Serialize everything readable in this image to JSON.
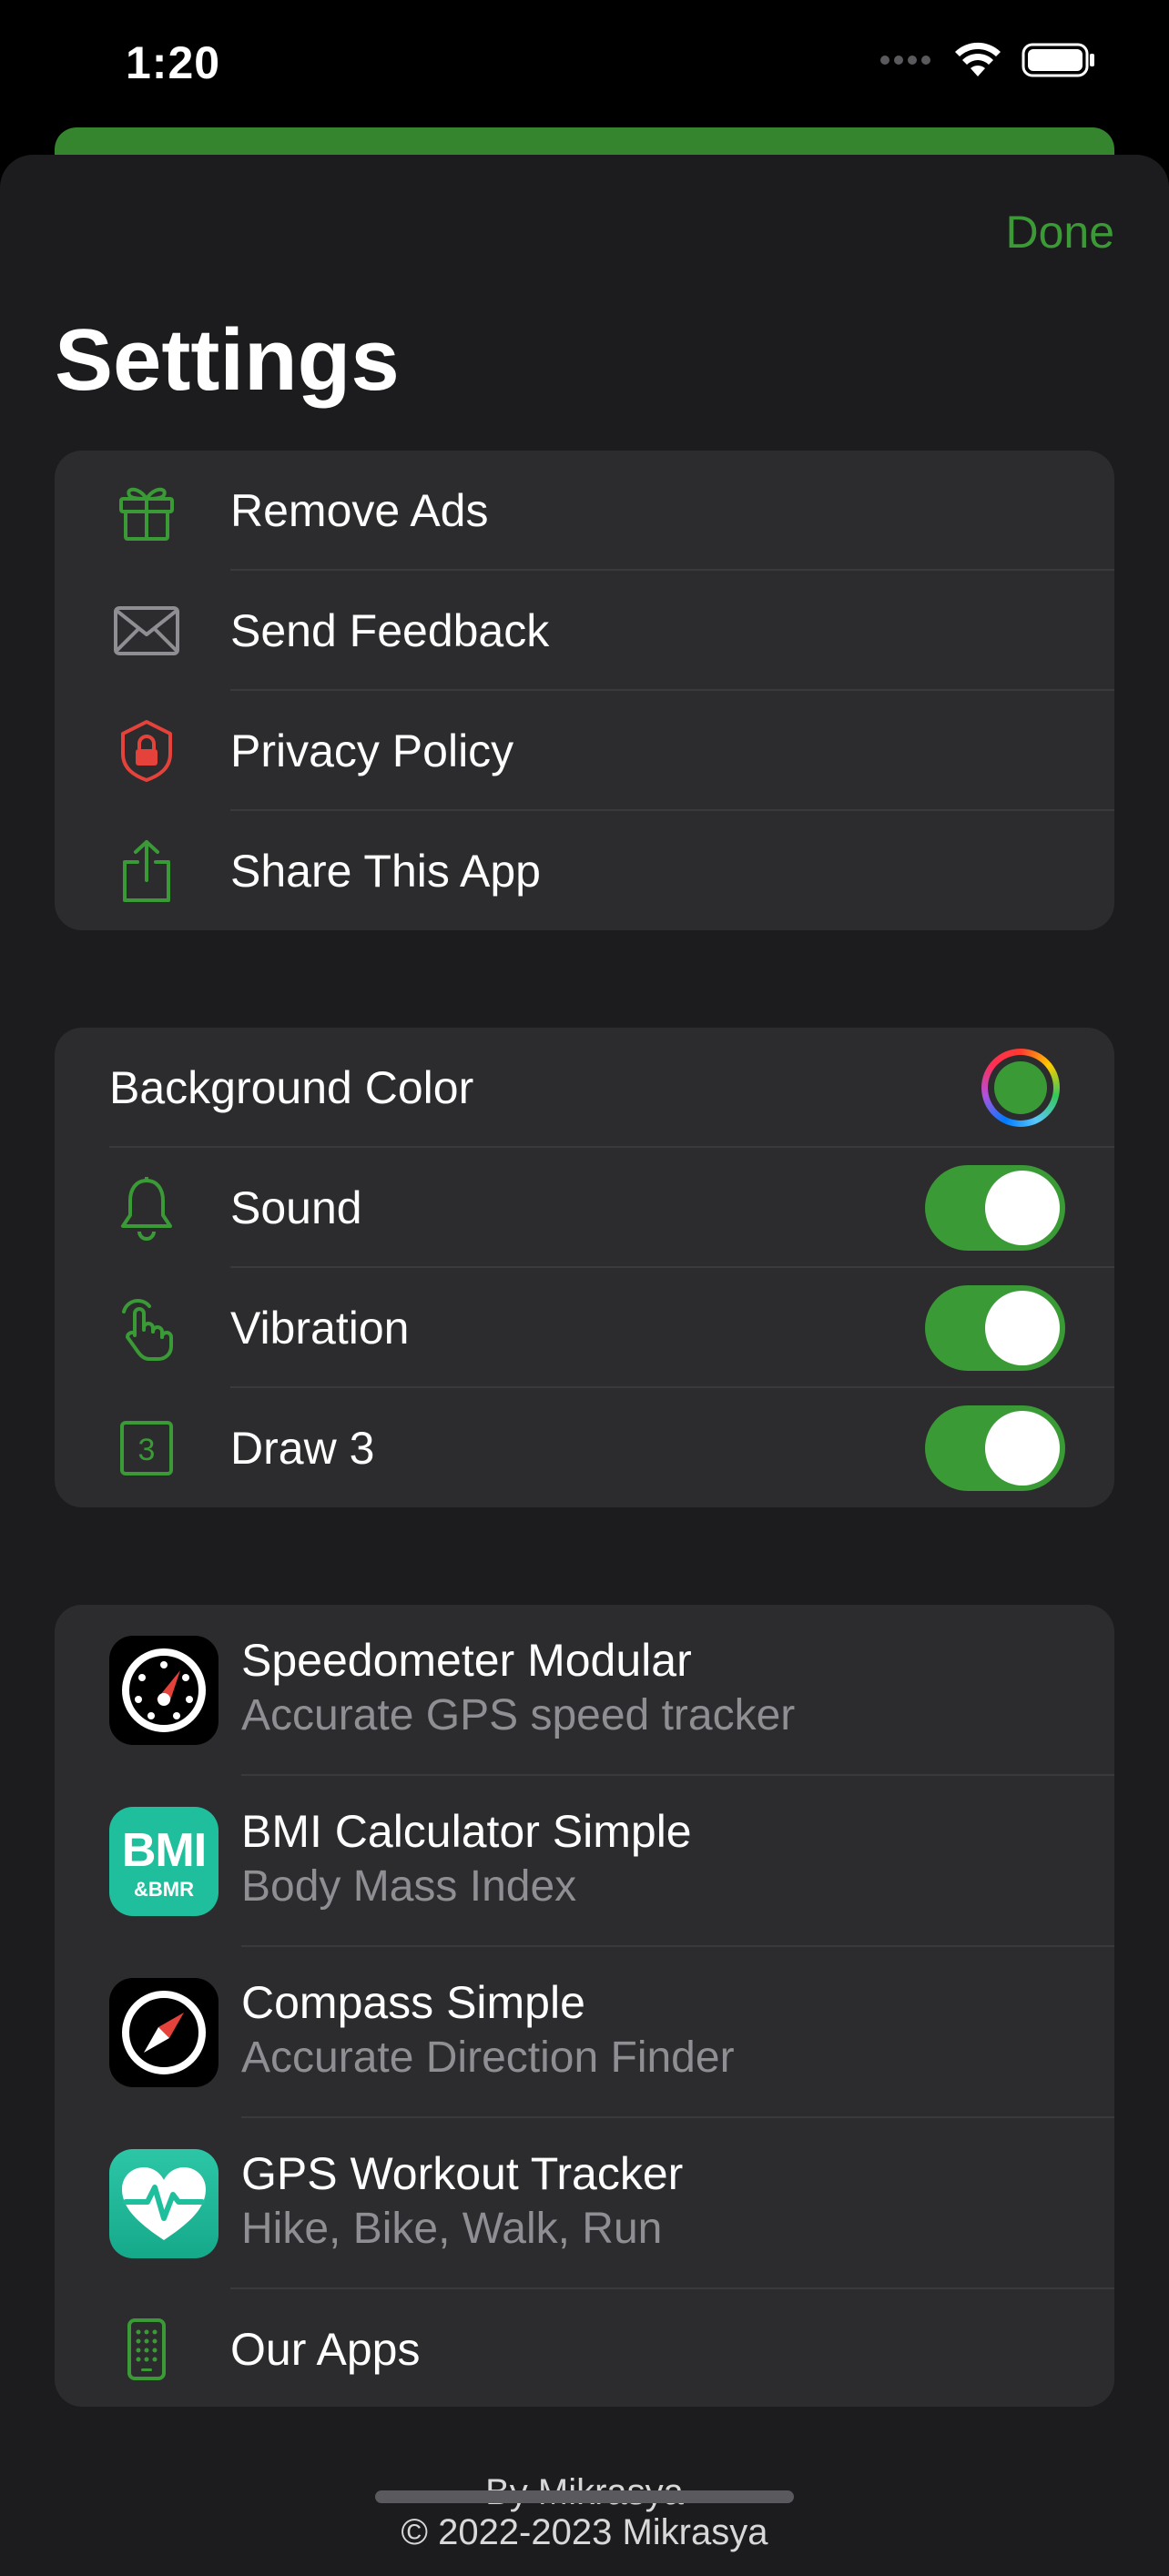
{
  "status_bar": {
    "time": "1:20"
  },
  "header": {
    "done_label": "Done",
    "title": "Settings"
  },
  "general_items": [
    {
      "label": "Remove Ads",
      "icon": "gift-icon"
    },
    {
      "label": "Send Feedback",
      "icon": "envelope-icon"
    },
    {
      "label": "Privacy Policy",
      "icon": "shield-lock-icon"
    },
    {
      "label": "Share This App",
      "icon": "share-icon"
    }
  ],
  "preferences": {
    "background_color": {
      "label": "Background Color",
      "value": "#3a9a36"
    },
    "toggles": [
      {
        "label": "Sound",
        "icon": "bell-icon",
        "on": true
      },
      {
        "label": "Vibration",
        "icon": "tap-hand-icon",
        "on": true
      },
      {
        "label": "Draw 3",
        "icon": "number-3-square-icon",
        "on": true
      }
    ]
  },
  "apps": [
    {
      "title": "Speedometer Modular",
      "subtitle": "Accurate GPS speed tracker",
      "icon": "speedometer-app-icon"
    },
    {
      "title": "BMI Calculator Simple",
      "subtitle": "Body Mass Index",
      "icon": "bmi-app-icon",
      "icon_text": "BMI",
      "icon_subtext": "&BMR"
    },
    {
      "title": "Compass Simple",
      "subtitle": "Accurate Direction Finder",
      "icon": "compass-app-icon"
    },
    {
      "title": "GPS Workout Tracker",
      "subtitle": "Hike, Bike, Walk, Run",
      "icon": "heart-pulse-app-icon"
    }
  ],
  "our_apps": {
    "label": "Our Apps",
    "icon": "phone-grid-icon"
  },
  "footer": {
    "by_line": "By Mikrasya",
    "copyright": "© 2022-2023 Mikrasya"
  },
  "colors": {
    "accent": "#3a9a36",
    "sheet": "#1c1c1e",
    "cell": "#2c2c2e",
    "secondary_text": "#8e8e93",
    "danger": "#e5423b",
    "teal": "#1fbf9e"
  }
}
